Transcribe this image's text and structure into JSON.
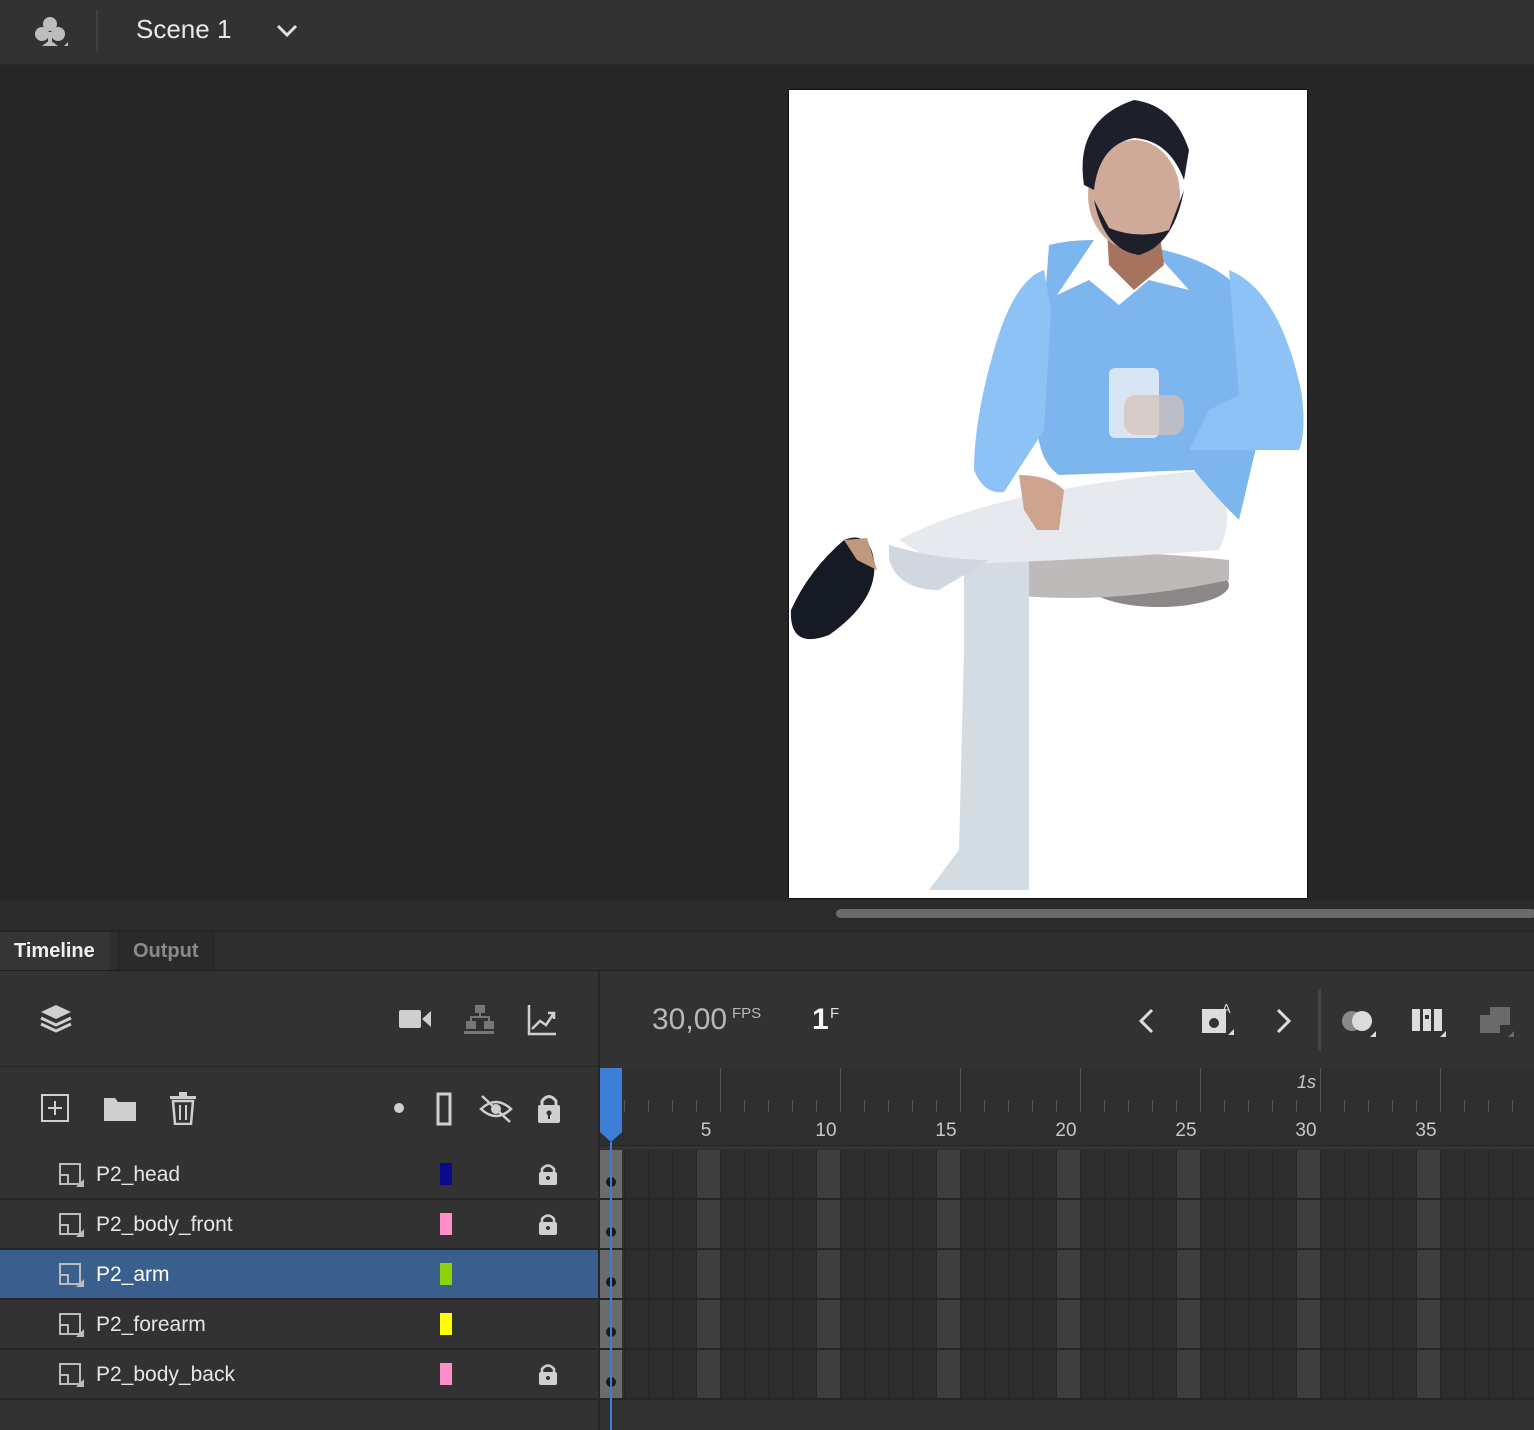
{
  "topbar": {
    "scene_icon": "club-icon",
    "scene_label": "Scene 1",
    "scene_menu_icon": "chevron-down-icon"
  },
  "panel_tabs": [
    {
      "label": "Timeline",
      "active": true
    },
    {
      "label": "Output",
      "active": false
    }
  ],
  "timeline": {
    "toolbar_icons": [
      "layers-icon",
      "camera-icon",
      "layer-depth-icon",
      "graph-icon"
    ],
    "layer_tools": [
      "add-layer-icon",
      "folder-icon",
      "trash-icon",
      "dot-icon",
      "outline-icon",
      "hide-icon",
      "lock-icon"
    ],
    "fps_value": "30,00",
    "fps_unit": "FPS",
    "frame_value": "1",
    "frame_unit": "F",
    "ruler_labels": [
      "5",
      "10",
      "15",
      "20",
      "25",
      "30",
      "35"
    ],
    "ruler_second_label": "1s",
    "nav_icons": [
      "prev-keyframe-icon",
      "insert-keyframe-icon",
      "next-keyframe-icon",
      "onion-skin-icon",
      "edit-multiple-frames-icon",
      "loop-icon"
    ],
    "layers": [
      {
        "name": "P2_head",
        "color": "#0a0a8a",
        "locked": true,
        "selected": false
      },
      {
        "name": "P2_body_front",
        "color": "#ff8fc8",
        "locked": true,
        "selected": false
      },
      {
        "name": "P2_arm",
        "color": "#8fd10a",
        "locked": false,
        "selected": true
      },
      {
        "name": "P2_forearm",
        "color": "#ffff00",
        "locked": false,
        "selected": false
      },
      {
        "name": "P2_body_back",
        "color": "#ff8fc8",
        "locked": true,
        "selected": false
      }
    ]
  },
  "colors": {
    "selection": "#3a5f8f",
    "playhead": "#3d7fd6"
  }
}
